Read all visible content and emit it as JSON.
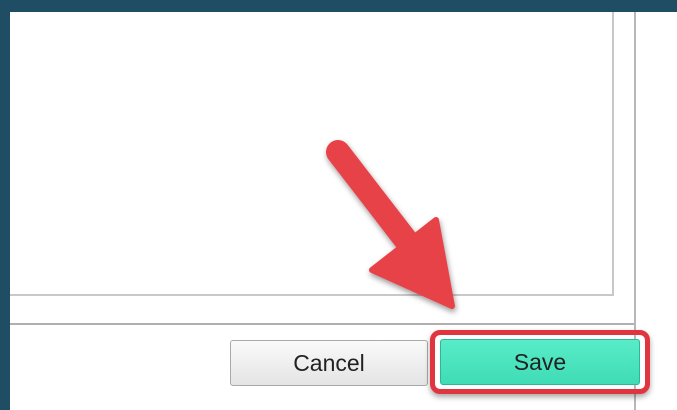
{
  "dialog": {
    "text_area": {
      "value": ""
    },
    "buttons": {
      "cancel_label": "Cancel",
      "save_label": "Save"
    }
  },
  "annotation": {
    "arrow_color": "#e8434a",
    "highlight_color": "#e0343f",
    "save_button_color": "#4de4bf"
  }
}
